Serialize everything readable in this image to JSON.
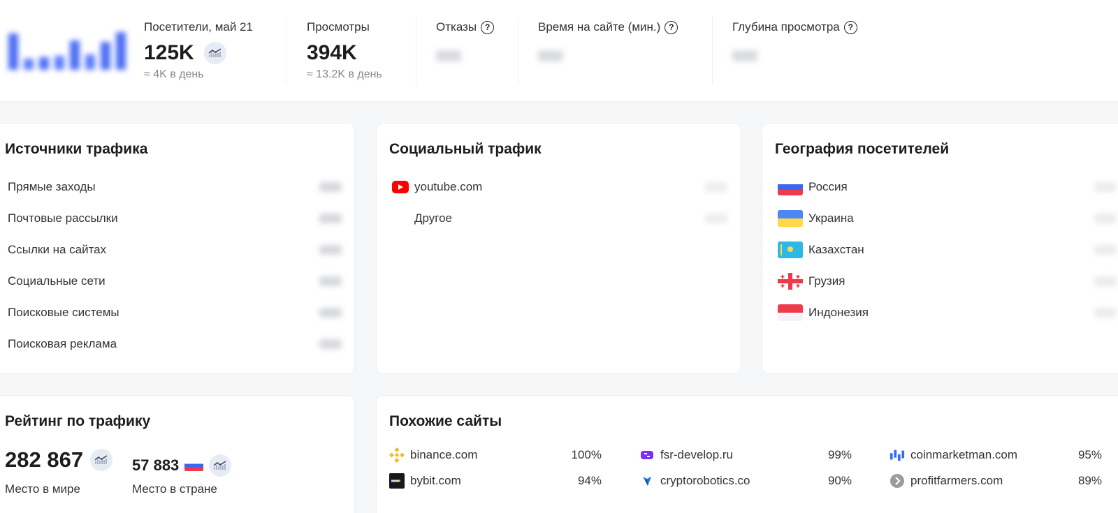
{
  "stats": {
    "visitors": {
      "label": "Посетители, май 21",
      "value": "125K",
      "sub": "≈ 4K в день"
    },
    "views": {
      "label": "Просмотры",
      "value": "394K",
      "sub": "≈ 13.2K в день"
    },
    "bounces": {
      "label": "Отказы"
    },
    "time": {
      "label": "Время на сайте (мин.)"
    },
    "depth": {
      "label": "Глубина просмотра"
    }
  },
  "traffic_sources": {
    "title": "Источники трафика",
    "items": [
      "Прямые заходы",
      "Почтовые рассылки",
      "Ссылки на сайтах",
      "Социальные сети",
      "Поисковые системы",
      "Поисковая реклама"
    ]
  },
  "social": {
    "title": "Социальный трафик",
    "items": [
      {
        "label": "youtube.com",
        "icon": "youtube-icon"
      },
      {
        "label": "Другое"
      }
    ]
  },
  "geo": {
    "title": "География посетителей",
    "items": [
      {
        "label": "Россия",
        "icon": "russia-flag-icon"
      },
      {
        "label": "Украина",
        "icon": "ukraine-flag-icon"
      },
      {
        "label": "Казахстан",
        "icon": "kazakhstan-flag-icon"
      },
      {
        "label": "Грузия",
        "icon": "georgia-flag-icon"
      },
      {
        "label": "Индонезия",
        "icon": "indonesia-flag-icon"
      }
    ]
  },
  "rating": {
    "title": "Рейтинг по трафику",
    "world_value": "282 867",
    "world_label": "Место в мире",
    "country_value": "57 883",
    "country_label": "Место в стране"
  },
  "similar": {
    "title": "Похожие сайты",
    "items": [
      {
        "name": "binance.com",
        "pct": "100%",
        "icon": "binance-icon"
      },
      {
        "name": "fsr-develop.ru",
        "pct": "99%",
        "icon": "fsr-icon"
      },
      {
        "name": "coinmarketman.com",
        "pct": "95%",
        "icon": "coinmarketman-icon"
      },
      {
        "name": "bybit.com",
        "pct": "94%",
        "icon": "bybit-icon"
      },
      {
        "name": "cryptorobotics.co",
        "pct": "90%",
        "icon": "cryptorobotics-icon"
      },
      {
        "name": "profitfarmers.com",
        "pct": "89%",
        "icon": "profitfarmers-icon"
      }
    ]
  },
  "colors": {
    "accent": "#4a6cf7",
    "youtube": "#ff0000"
  }
}
